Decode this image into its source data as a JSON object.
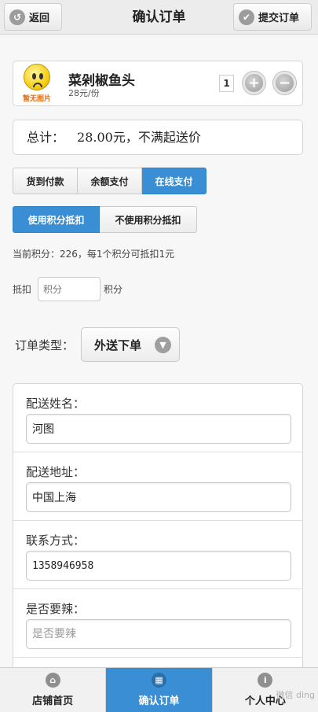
{
  "header": {
    "title": "确认订单",
    "back_label": "返回",
    "submit_label": "提交订单",
    "back_icon": "arrow-left-circle-icon",
    "submit_icon": "check-circle-icon"
  },
  "product": {
    "image_text": "暂无图片",
    "name": "菜剁椒鱼头",
    "price": "28元/份",
    "quantity": "1"
  },
  "total": {
    "label": "总计：",
    "value": "28.00元，不满起送价"
  },
  "payment": {
    "options": [
      "货到付款",
      "余额支付",
      "在线支付"
    ],
    "selected": "在线支付"
  },
  "points": {
    "options": [
      "使用积分抵扣",
      "不使用积分抵扣"
    ],
    "selected": "使用积分抵扣",
    "info": "当前积分：226，每1个积分可抵扣1元",
    "deduct_label": "抵扣",
    "deduct_placeholder": "积分",
    "deduct_unit": "积分"
  },
  "order_type": {
    "label": "订单类型：",
    "value": "外送下单"
  },
  "form": {
    "name_label": "配送姓名：",
    "name_value": "河图",
    "address_label": "配送地址：",
    "address_value": "中国上海",
    "contact_label": "联系方式：",
    "contact_value": "1358946958",
    "spicy_label": "是否要辣：",
    "spicy_placeholder": "是否要辣"
  },
  "footer": {
    "tabs": [
      {
        "label": "店铺首页",
        "icon": "home-icon"
      },
      {
        "label": "确认订单",
        "icon": "grid-icon"
      },
      {
        "label": "个人中心",
        "icon": "info-icon"
      }
    ],
    "active": "确认订单"
  },
  "watermark": "微信 ding",
  "colors": {
    "accent": "#3a8ed4",
    "header_bg": "#ececec",
    "page_bg": "#f7f7f7"
  }
}
